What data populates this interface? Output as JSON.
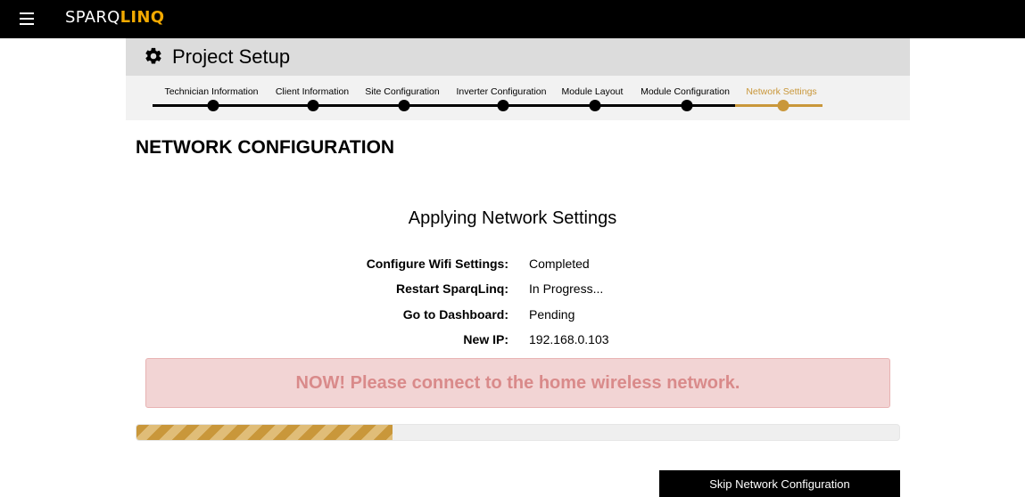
{
  "brand": {
    "part1": "SPARQ",
    "part2": "LINQ"
  },
  "setup": {
    "title": "Project Setup",
    "steps": [
      {
        "label": "Technician Information"
      },
      {
        "label": "Client Information"
      },
      {
        "label": "Site Configuration"
      },
      {
        "label": "Inverter Configuration"
      },
      {
        "label": "Module Layout"
      },
      {
        "label": "Module Configuration"
      },
      {
        "label": "Network Settings",
        "active": true
      }
    ]
  },
  "main": {
    "section_title": "NETWORK CONFIGURATION",
    "subtitle": "Applying Network Settings",
    "status": [
      {
        "key": "Configure Wifi Settings:",
        "value": "Completed"
      },
      {
        "key": "Restart SparqLinq:",
        "value": "In Progress..."
      },
      {
        "key": "Go to Dashboard:",
        "value": "Pending"
      },
      {
        "key": "New IP:",
        "value": "192.168.0.103"
      }
    ],
    "alert": "NOW! Please connect to the home wireless network.",
    "progress_percent": 33.6,
    "skip_label": "Skip Network Configuration"
  },
  "colors": {
    "accent": "#c9973a",
    "topbar": "#000000",
    "alert_bg": "#f2d4d4",
    "alert_text": "#d98a8a"
  }
}
